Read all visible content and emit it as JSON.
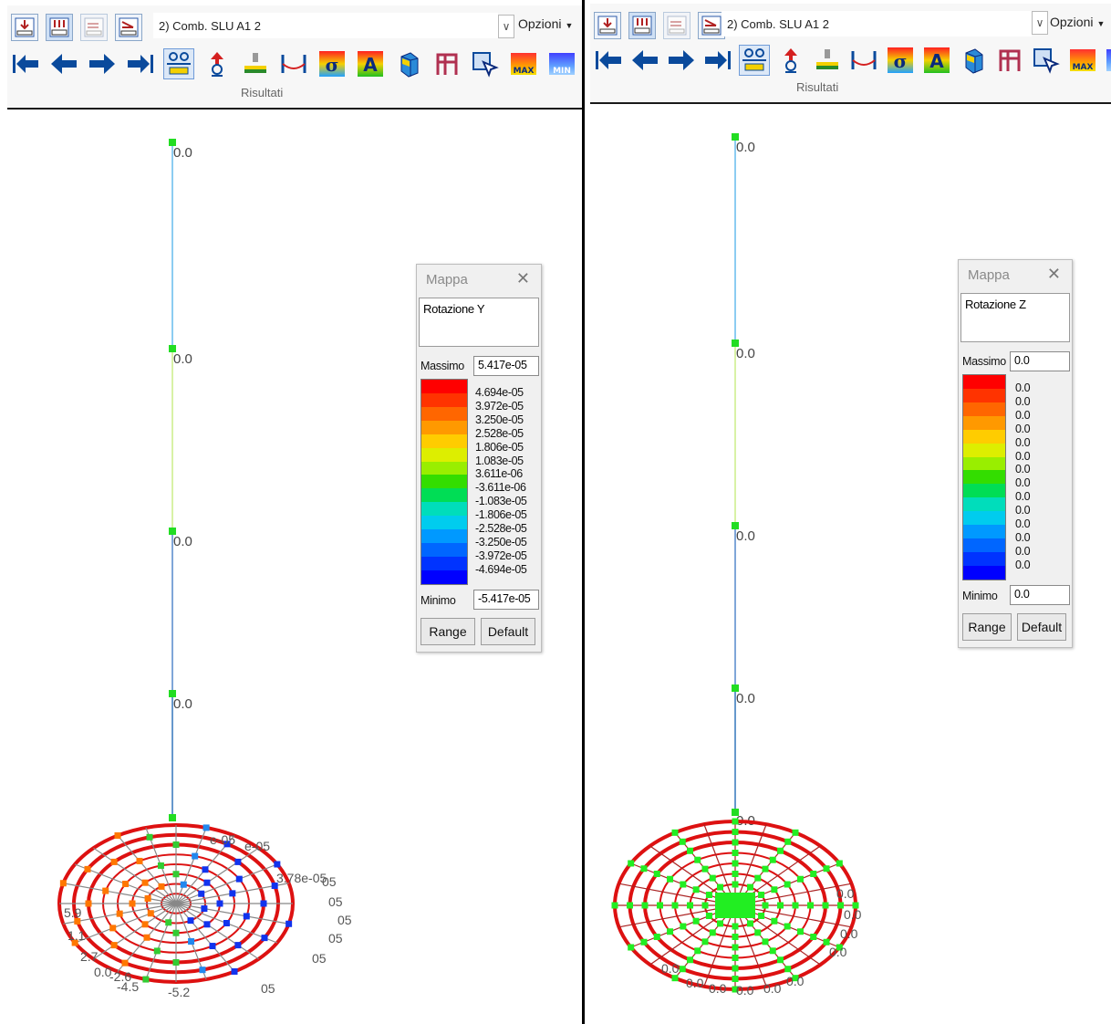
{
  "left": {
    "toolbar": {
      "combo_value": "2) Comb. SLU A1 2",
      "options_label": "Opzioni",
      "group_label": "Risultati",
      "icons": [
        "arrow-left-end-icon",
        "arrow-left-icon",
        "arrow-right-icon",
        "arrow-right-end-icon",
        "deformed-shape-icon",
        "reaction-icon",
        "load-distribution-icon",
        "beam-diagram-icon",
        "sigma-stress-icon",
        "a-label-icon",
        "solid-view-icon",
        "frame-icon",
        "select-icon",
        "max-icon",
        "min-icon"
      ]
    },
    "node_labels": [
      "0.0",
      "0.0",
      "0.0",
      "0.0"
    ],
    "cluster_labels": [
      "-4.5",
      "-5.2",
      "-2.6",
      "5.9",
      "1.1",
      "2.7",
      "0.0",
      "e-05",
      "e-05",
      "3.78e-05",
      "05",
      "05",
      "05",
      "05",
      "05",
      "05"
    ],
    "mappa": {
      "title": "Mappa",
      "quantity": "Rotazione Y",
      "max_label": "Massimo",
      "max_value": "5.417e-05",
      "min_label": "Minimo",
      "min_value": "-5.417e-05",
      "legend_values": [
        "4.694e-05",
        "3.972e-05",
        "3.250e-05",
        "2.528e-05",
        "1.806e-05",
        "1.083e-05",
        "3.611e-06",
        "-3.611e-06",
        "-1.083e-05",
        "-1.806e-05",
        "-2.528e-05",
        "-3.250e-05",
        "-3.972e-05",
        "-4.694e-05"
      ],
      "range_label": "Range",
      "default_label": "Default"
    }
  },
  "right": {
    "toolbar": {
      "combo_value": "2) Comb. SLU A1 2",
      "options_label": "Opzioni",
      "group_label": "Risultati"
    },
    "node_labels": [
      "0.0",
      "0.0",
      "0.0",
      "0.0",
      "0.0"
    ],
    "cluster_labels": [
      "0.0",
      "0.0",
      "0.0",
      "0.0",
      "0.0",
      "0.0",
      "0.0",
      "0.0",
      "0.0",
      "0.0"
    ],
    "mappa": {
      "title": "Mappa",
      "quantity": "Rotazione Z",
      "max_label": "Massimo",
      "max_value": "0.0",
      "min_label": "Minimo",
      "min_value": "0.0",
      "legend_values": [
        "0.0",
        "0.0",
        "0.0",
        "0.0",
        "0.0",
        "0.0",
        "0.0",
        "0.0",
        "0.0",
        "0.0",
        "0.0",
        "0.0",
        "0.0",
        "0.0"
      ],
      "range_label": "Range",
      "default_label": "Default"
    }
  },
  "legend_colors": [
    "#ff0000",
    "#ff3300",
    "#ff6600",
    "#ff9900",
    "#ffcc00",
    "#ddee00",
    "#99ee00",
    "#33dd00",
    "#00dd55",
    "#00ddbb",
    "#00ccee",
    "#0099ff",
    "#0066ff",
    "#0033ff",
    "#0000ff"
  ]
}
